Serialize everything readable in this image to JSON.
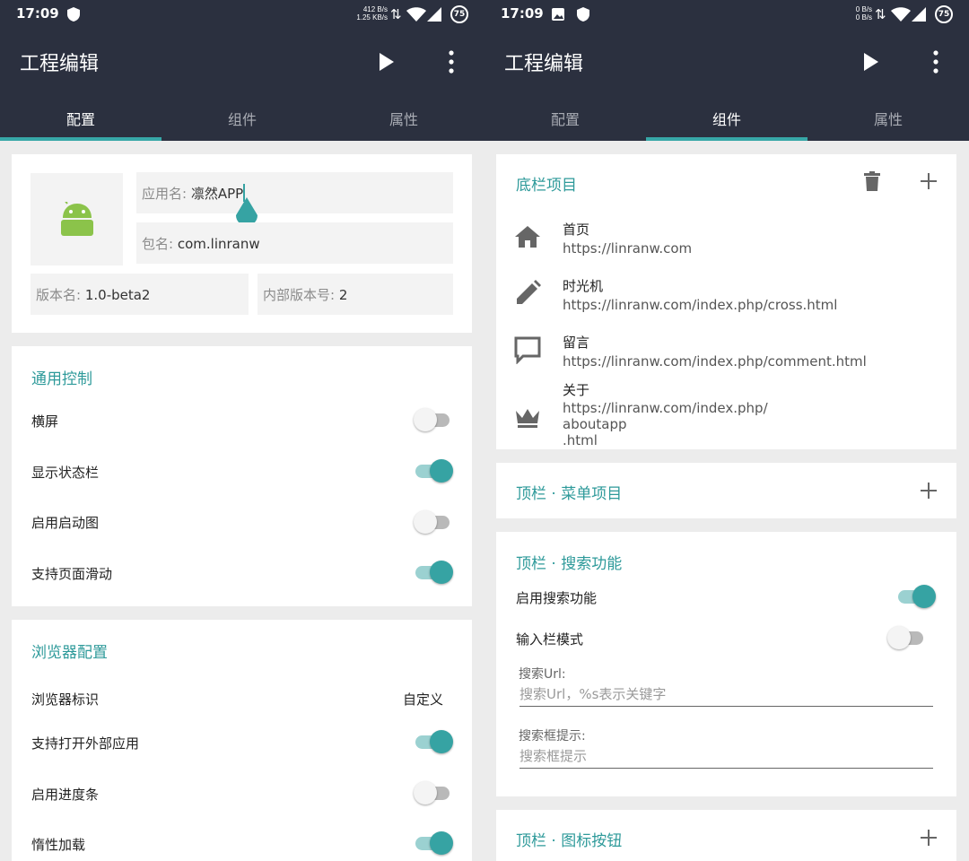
{
  "app": {
    "title": "工程编辑",
    "tabs": [
      "配置",
      "组件",
      "属性"
    ],
    "accent": "#37a7a7",
    "appbar_color": "#2b303f"
  },
  "left": {
    "statusbar": {
      "time": "17:09",
      "net_up": "412 B/s",
      "net_down": "1.25 KB/s",
      "battery": "75"
    },
    "app_info": {
      "app_name_label": "应用名:",
      "app_name_value": "凛然APP",
      "package_label": "包名:",
      "package_value": "com.linranw",
      "version_name_label": "版本名:",
      "version_name_value": "1.0-beta2",
      "version_code_label": "内部版本号:",
      "version_code_value": "2"
    },
    "general": {
      "title": "通用控制",
      "items": [
        {
          "label": "横屏",
          "on": false
        },
        {
          "label": "显示状态栏",
          "on": true
        },
        {
          "label": "启用启动图",
          "on": false
        },
        {
          "label": "支持页面滑动",
          "on": true
        }
      ]
    },
    "browser": {
      "title": "浏览器配置",
      "ua_label": "浏览器标识",
      "ua_value": "自定义",
      "items": [
        {
          "label": "支持打开外部应用",
          "on": true
        },
        {
          "label": "启用进度条",
          "on": false
        },
        {
          "label": "惰性加载",
          "on": true
        }
      ]
    }
  },
  "right": {
    "statusbar": {
      "time": "17:09",
      "net_up": "0 B/s",
      "net_down": "0 B/s",
      "battery": "75"
    },
    "bottom_bar": {
      "title": "底栏项目",
      "items": [
        {
          "icon": "home-icon",
          "name": "首页",
          "url": "https://linranw.com"
        },
        {
          "icon": "pencil-icon",
          "name": "时光机",
          "url": "https://linranw.com/index.php/cross.html"
        },
        {
          "icon": "comment-icon",
          "name": "留言",
          "url": "https://linranw.com/index.php/comment.html"
        },
        {
          "icon": "crown-icon",
          "name": "关于",
          "url": "https://linranw.com/index.php/\naboutapp\n.html"
        }
      ]
    },
    "menu_section": {
      "title": "顶栏 · 菜单项目"
    },
    "search_section": {
      "title": "顶栏 · 搜索功能",
      "enable_label": "启用搜索功能",
      "enable_on": true,
      "input_mode_label": "输入栏模式",
      "input_mode_on": false,
      "url_label": "搜索Url:",
      "url_placeholder": "搜索Url，%s表示关键字",
      "hint_label": "搜索框提示:",
      "hint_placeholder": "搜索框提示"
    },
    "icon_button_section": {
      "title": "顶栏 · 图标按钮"
    }
  }
}
